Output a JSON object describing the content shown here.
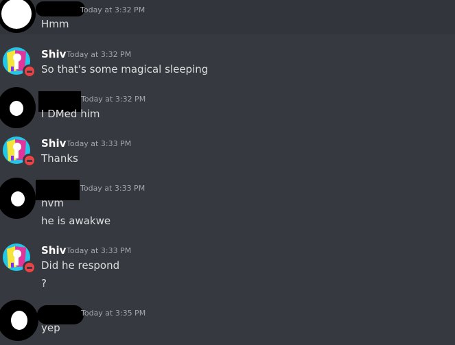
{
  "messages": [
    {
      "author": "",
      "time": "Today at 3:32 PM",
      "lines": [
        "Hmm"
      ]
    },
    {
      "author": "Shiv",
      "time": "Today at 3:32 PM",
      "lines": [
        "So that's some magical sleeping"
      ]
    },
    {
      "author": "",
      "time": "Today at 3:32 PM",
      "lines": [
        "I DMed him"
      ]
    },
    {
      "author": "Shiv",
      "time": "Today at 3:33 PM",
      "lines": [
        "Thanks"
      ]
    },
    {
      "author": "",
      "time": "Today at 3:33 PM",
      "lines": [
        "nvm",
        "he is awakwe"
      ]
    },
    {
      "author": "Shiv",
      "time": "Today at 3:33 PM",
      "lines": [
        "Did he respond",
        "?"
      ]
    },
    {
      "author": "",
      "time": "Today at 3:35 PM",
      "lines": [
        "yep"
      ]
    }
  ],
  "icons": {
    "black_avatar": "avatar-redacted",
    "shiv_avatar": "shiv-avatar",
    "status": "dnd-status-icon"
  },
  "colors": {
    "background": "#36393f",
    "dnd": "#ed4245",
    "username": "#ffffff",
    "timestamp": "#a3a6aa"
  }
}
